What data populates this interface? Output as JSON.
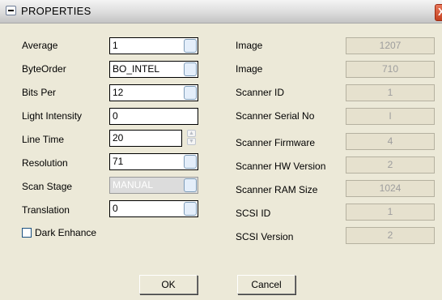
{
  "window": {
    "title": "PROPERTIES",
    "close_glyph": "X"
  },
  "left_fields": [
    {
      "label": "Average",
      "value": "1",
      "control": "dropdown",
      "enabled": true
    },
    {
      "label": "ByteOrder",
      "value": "BO_INTEL",
      "control": "dropdown",
      "enabled": true
    },
    {
      "label": "Bits Per",
      "value": "12",
      "control": "dropdown",
      "enabled": true
    },
    {
      "label": "Light Intensity",
      "value": "0",
      "control": "text",
      "enabled": true
    },
    {
      "label": "Line Time",
      "value": "20",
      "control": "spinner",
      "enabled": true
    },
    {
      "label": "Resolution",
      "value": "71",
      "control": "dropdown",
      "enabled": true
    },
    {
      "label": "Scan Stage",
      "value": "MANUAL",
      "control": "dropdown",
      "enabled": false
    },
    {
      "label": "Translation",
      "value": "0",
      "control": "dropdown",
      "enabled": true
    }
  ],
  "dark_enhance": {
    "label": "Dark Enhance",
    "checked": false
  },
  "right_fields": [
    {
      "label": "Image",
      "value": "1207"
    },
    {
      "label": "Image",
      "value": "710"
    },
    {
      "label": "Scanner ID",
      "value": "1"
    },
    {
      "label": "Scanner Serial No",
      "value": "I"
    },
    {
      "label": "Scanner Firmware",
      "value": "4"
    },
    {
      "label": "Scanner HW Version",
      "value": "2"
    },
    {
      "label": "Scanner RAM Size",
      "value": "1024"
    },
    {
      "label": "SCSI ID",
      "value": "1"
    },
    {
      "label": "SCSI Version",
      "value": "2"
    }
  ],
  "buttons": {
    "ok": "OK",
    "cancel": "Cancel"
  },
  "icons": {
    "system_menu": "minus-icon",
    "close": "close-icon",
    "dropdown": "dropdown-button-icon",
    "spinner": "spinner-arrows-icon"
  },
  "colors": {
    "dialog_bg": "#ece9d8",
    "readonly_bg": "#e6e1ce",
    "readonly_text": "#9d9d9d",
    "close_red": "#d2502d"
  }
}
